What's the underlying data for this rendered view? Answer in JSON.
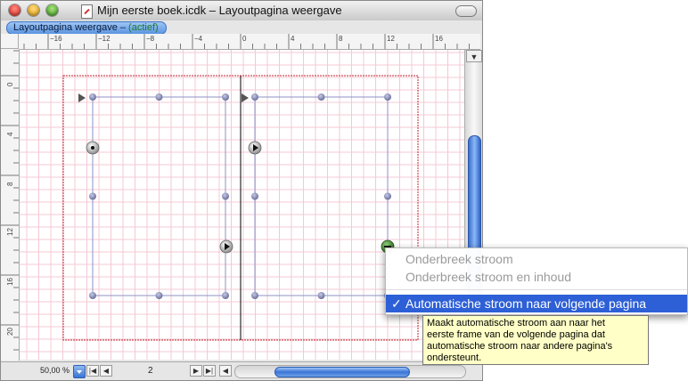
{
  "window": {
    "title": "Mijn eerste boek.icdk – Layoutpagina weergave",
    "traffic_lights": [
      "close",
      "minimize",
      "zoom"
    ]
  },
  "tab": {
    "label": "Layoutpagina weergave – ",
    "status": "(actief)"
  },
  "rulers": {
    "top_ticks": [
      "−16",
      "−12",
      "−8",
      "−4",
      "0",
      "4",
      "8",
      "12",
      "16"
    ],
    "left_ticks": [
      "0",
      "4",
      "8",
      "12",
      "16",
      "20"
    ]
  },
  "bottom_bar": {
    "zoom": "50,00 %",
    "page_number": "2"
  },
  "context_menu": {
    "items": [
      {
        "label": "Onderbreek stroom",
        "enabled": false,
        "checked": false
      },
      {
        "label": "Onderbreek stroom en inhoud",
        "enabled": false,
        "checked": false
      },
      {
        "label": "Automatische stroom naar volgende pagina",
        "enabled": true,
        "checked": true
      }
    ],
    "check_glyph": "✓"
  },
  "tooltip": {
    "lines": [
      "Maakt automatische stroom aan naar het",
      "eerste  frame van de volgende pagina dat",
      "automatische stroom naar andere pagina's",
      "ondersteunt."
    ]
  },
  "colors": {
    "accent": "#2d5fd6",
    "page_border": "#c0272d",
    "grid": "#f4c8d4",
    "frame_line": "#8f92c4",
    "handle": "#7a7fa8",
    "tooltip_bg": "#ffffc7",
    "tab_active": "#1e7a2a"
  },
  "icons": {
    "close": "close-icon",
    "minimize": "minimize-icon",
    "zoom": "zoom-icon",
    "doc": "document-icon",
    "flow_left": "flow-arrow-icon",
    "flow_out": "flow-out-icon",
    "flow_link": "flow-link-icon",
    "flow_auto": "auto-flow-icon"
  }
}
